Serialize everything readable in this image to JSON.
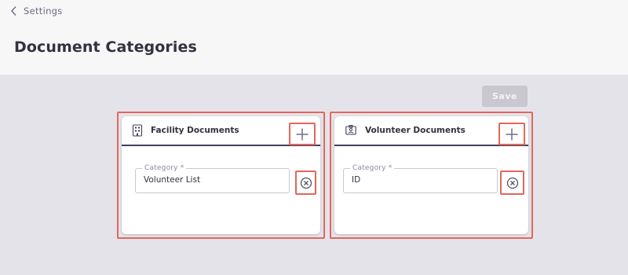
{
  "header": {
    "back_label": "Settings",
    "title": "Document Categories"
  },
  "toolbar": {
    "save_label": "Save"
  },
  "panels": [
    {
      "title": "Facility Documents",
      "icon": "building-icon",
      "category_field": {
        "label": "Category *",
        "value": "Volunteer List"
      }
    },
    {
      "title": "Volunteer Documents",
      "icon": "id-badge-icon",
      "category_field": {
        "label": "Category *",
        "value": "ID"
      }
    }
  ],
  "colors": {
    "highlight": "#e2675b",
    "header_divider": "#3f3f5c",
    "save_disabled": "#c9c8cf",
    "background": "#e5e3ea"
  }
}
